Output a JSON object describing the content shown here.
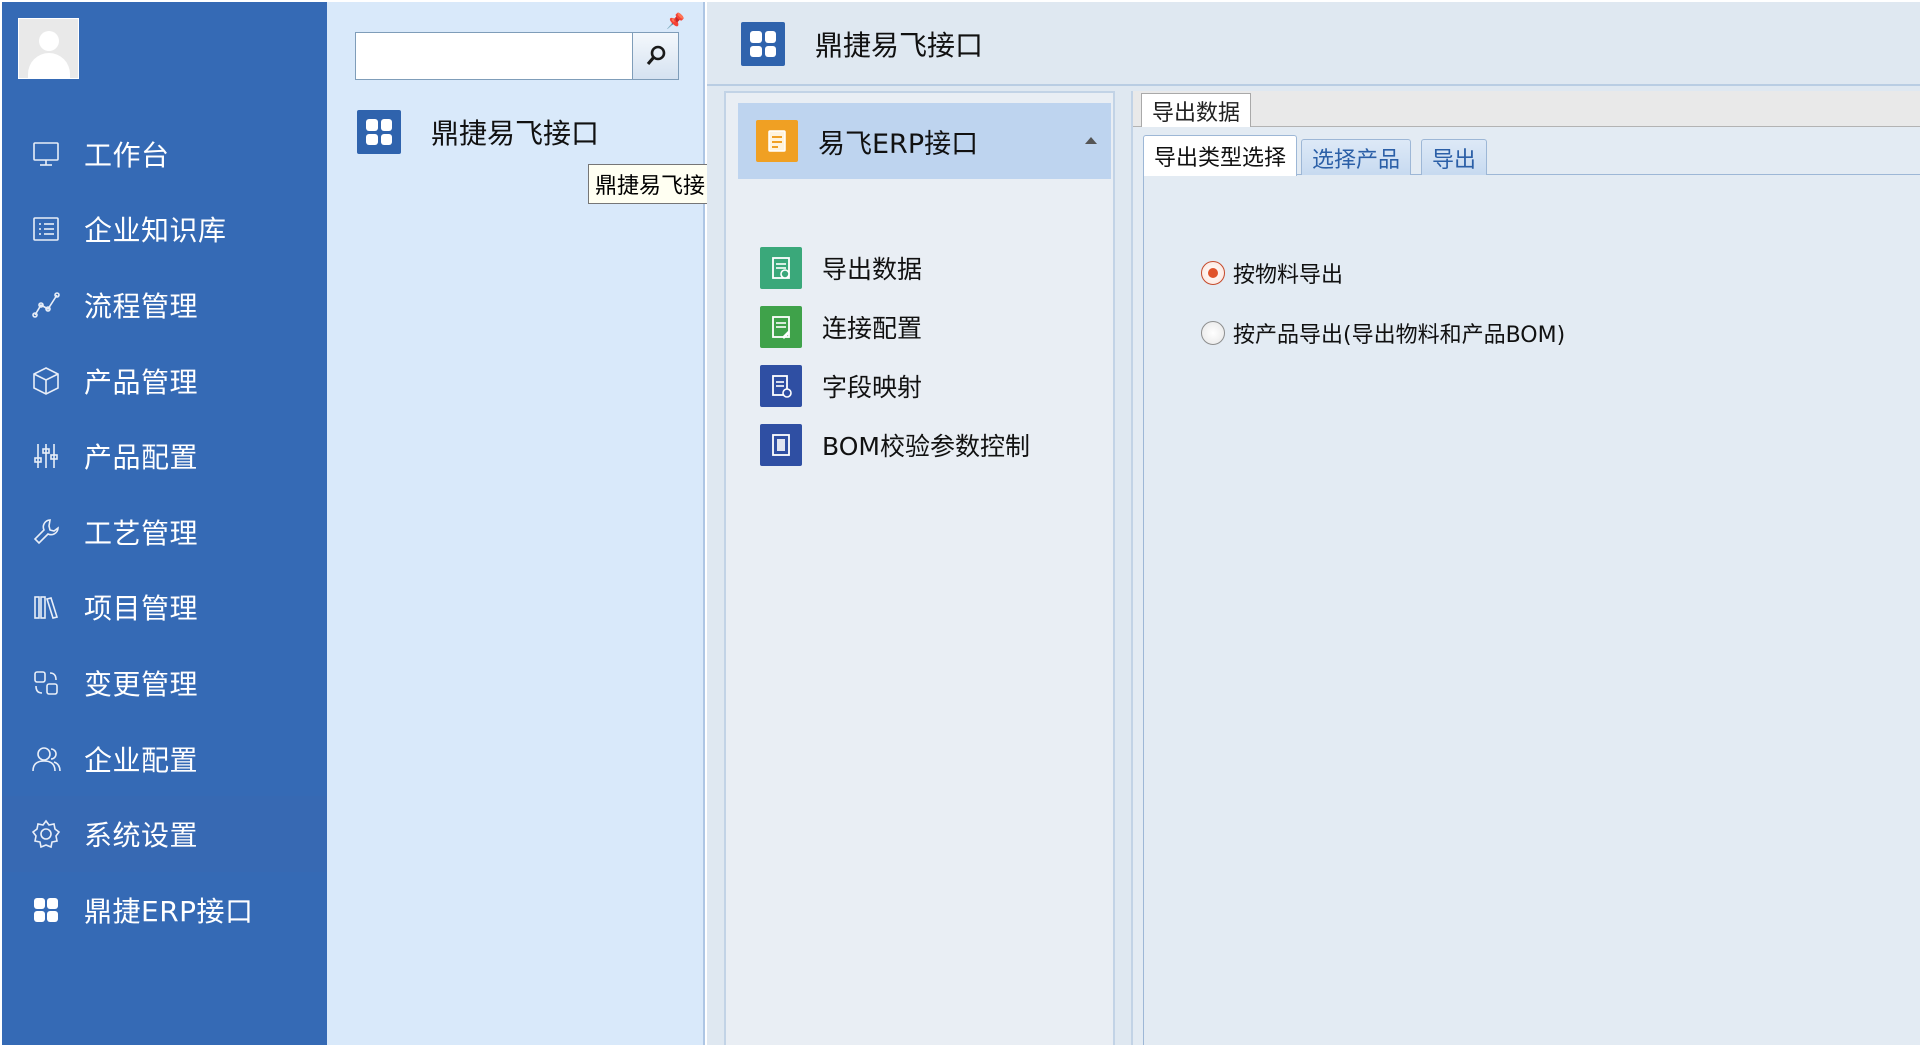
{
  "sidebar": {
    "items": [
      {
        "label": "工作台",
        "icon": "monitor-icon"
      },
      {
        "label": "企业知识库",
        "icon": "list-icon"
      },
      {
        "label": "流程管理",
        "icon": "flow-chart-icon"
      },
      {
        "label": "产品管理",
        "icon": "cube-icon"
      },
      {
        "label": "产品配置",
        "icon": "sliders-icon"
      },
      {
        "label": "工艺管理",
        "icon": "wrench-icon"
      },
      {
        "label": "项目管理",
        "icon": "books-icon"
      },
      {
        "label": "变更管理",
        "icon": "change-icon"
      },
      {
        "label": "企业配置",
        "icon": "users-icon"
      },
      {
        "label": "系统设置",
        "icon": "gear-icon"
      },
      {
        "label": "鼎捷ERP接口",
        "icon": "grid-icon"
      }
    ]
  },
  "module_panel": {
    "search_placeholder": "",
    "search_value": "",
    "item_label": "鼎捷易飞接口",
    "tooltip": "鼎捷易飞接口"
  },
  "content": {
    "title": "鼎捷易飞接口",
    "subnav": {
      "group_label": "易飞ERP接口",
      "items": [
        {
          "label": "导出数据",
          "icon": "export-data-icon",
          "color": "#3aa87a"
        },
        {
          "label": "连接配置",
          "icon": "connection-config-icon",
          "color": "#3fa24a"
        },
        {
          "label": "字段映射",
          "icon": "field-mapping-icon",
          "color": "#2f4fa3"
        },
        {
          "label": "BOM校验参数控制",
          "icon": "bom-check-icon",
          "color": "#2f4fa3"
        }
      ]
    },
    "detail": {
      "outer_tab": "导出数据",
      "inner_tabs": [
        "导出类型选择",
        "选择产品",
        "导出"
      ],
      "options": [
        {
          "label": "按物料导出",
          "selected": true
        },
        {
          "label": "按产品导出(导出物料和产品BOM)",
          "selected": false
        }
      ]
    }
  },
  "colors": {
    "sidebar_bg": "#356ab5",
    "module_panel_bg": "#d9e9fa",
    "tile_blue": "#2f63ad",
    "group_orange": "#f0a023",
    "selected_radio": "#e0532b"
  }
}
